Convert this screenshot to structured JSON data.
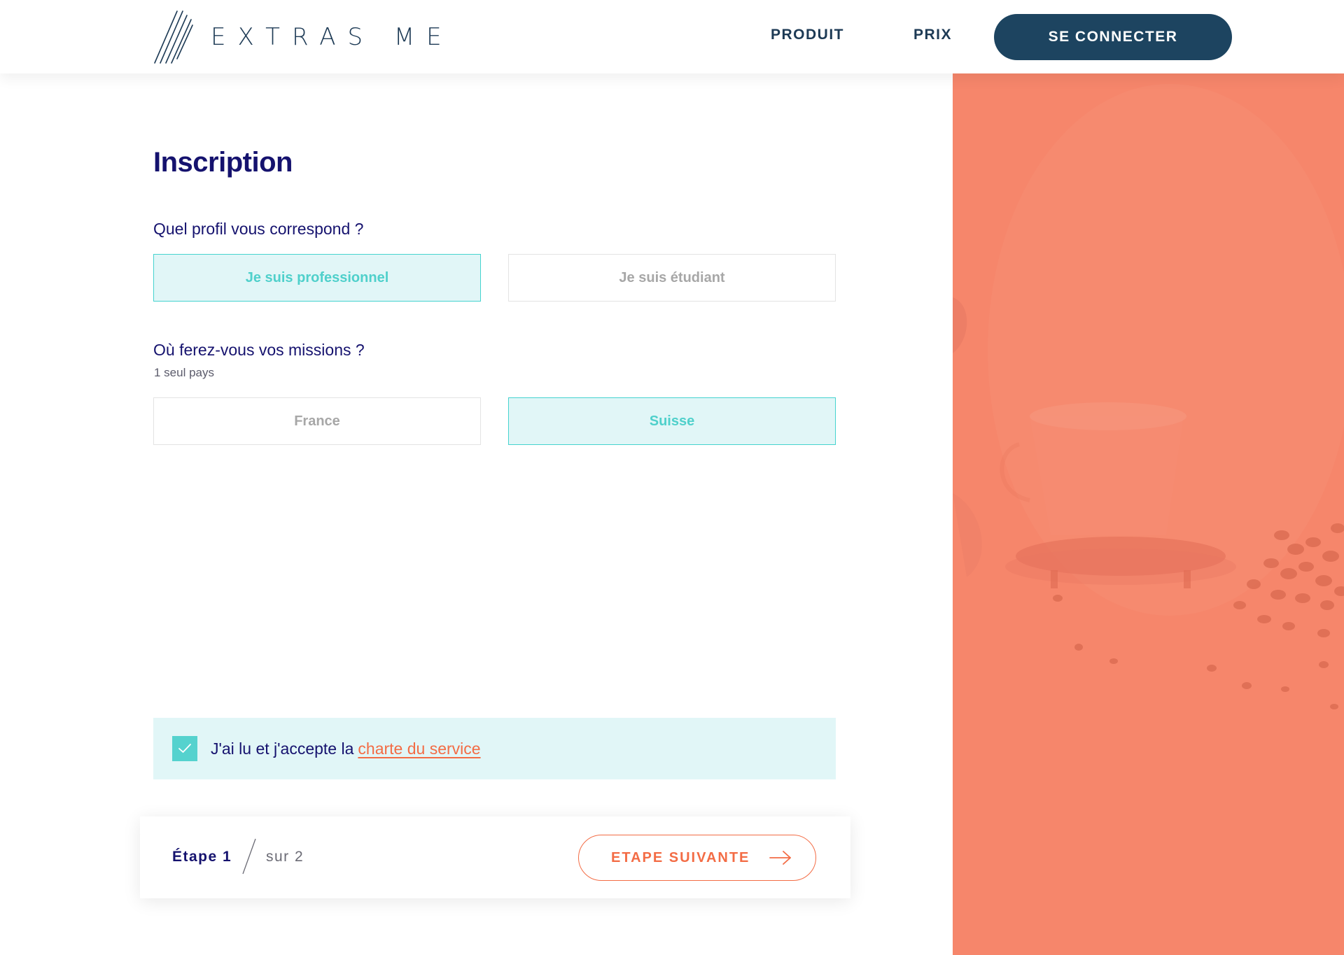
{
  "header": {
    "logo_text": "EXTRAS ME",
    "nav": [
      {
        "label": "PRODUIT"
      },
      {
        "label": "PRIX"
      }
    ],
    "login_button": "SE CONNECTER"
  },
  "form": {
    "title": "Inscription",
    "profile_question": "Quel profil vous correspond ?",
    "profile_options": [
      {
        "label": "Je suis professionnel",
        "selected": true
      },
      {
        "label": "Je suis étudiant",
        "selected": false
      }
    ],
    "country_question": "Où ferez-vous vos missions ?",
    "country_hint": "1 seul pays",
    "country_options": [
      {
        "label": "France",
        "selected": false
      },
      {
        "label": "Suisse",
        "selected": true
      }
    ],
    "consent": {
      "checked": true,
      "text": "J'ai lu et j'accepte la",
      "link": "charte du service"
    }
  },
  "footer": {
    "step_current": "Étape 1",
    "step_total": "sur 2",
    "next_button": "ETAPE SUIVANTE"
  },
  "colors": {
    "navy": "#15126e",
    "header_navy": "#1d4460",
    "teal": "#4fd0cb",
    "teal_bg": "#e1f6f7",
    "coral": "#f36c45",
    "side_panel": "#f6866b"
  },
  "icons": {
    "logo": "logo-lines-icon",
    "checkbox": "check-icon",
    "step_divider": "slash-icon",
    "next": "arrow-right-icon"
  }
}
